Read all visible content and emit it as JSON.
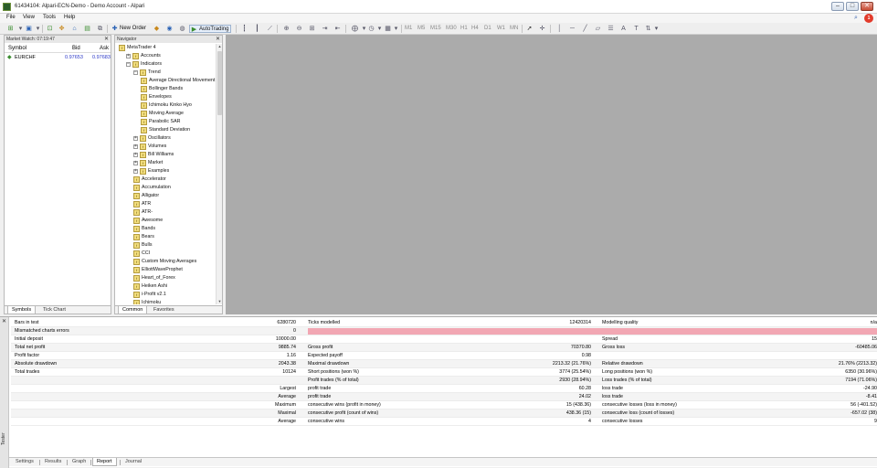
{
  "window": {
    "title": "61434104: Alpari-ECN-Demo - Demo Account - Alpari",
    "min": "–",
    "max": "□",
    "close": "✕"
  },
  "menu": [
    "File",
    "View",
    "Tools",
    "Help"
  ],
  "toolbar": {
    "new_order": "New Order",
    "auto_trading": "AutoTrading",
    "periods": [
      "M1",
      "M5",
      "M15",
      "M30",
      "H1",
      "H4",
      "D1",
      "W1",
      "MN"
    ]
  },
  "market_watch": {
    "title": "Market Watch: 07:19:47",
    "close": "✕",
    "headers": {
      "symbol": "Symbol",
      "bid": "Bid",
      "ask": "Ask"
    },
    "rows": [
      {
        "symbol": "EURCHF",
        "bid": "0.97653",
        "ask": "0.97683"
      }
    ],
    "tabs": [
      "Symbols",
      "Tick Chart"
    ]
  },
  "navigator": {
    "title": "Navigator",
    "close": "✕",
    "tree": [
      {
        "label": "MetaTrader 4",
        "level": 0,
        "exp": ""
      },
      {
        "label": "Accounts",
        "level": 1,
        "exp": "+"
      },
      {
        "label": "Indicators",
        "level": 1,
        "exp": "−"
      },
      {
        "label": "Trend",
        "level": 2,
        "exp": "−"
      },
      {
        "label": "Average Directional Movement Index",
        "level": 3,
        "exp": ""
      },
      {
        "label": "Bollinger Bands",
        "level": 3,
        "exp": ""
      },
      {
        "label": "Envelopes",
        "level": 3,
        "exp": ""
      },
      {
        "label": "Ichimoku Kinko Hyo",
        "level": 3,
        "exp": ""
      },
      {
        "label": "Moving Average",
        "level": 3,
        "exp": ""
      },
      {
        "label": "Parabolic SAR",
        "level": 3,
        "exp": ""
      },
      {
        "label": "Standard Deviation",
        "level": 3,
        "exp": ""
      },
      {
        "label": "Oscillators",
        "level": 2,
        "exp": "+"
      },
      {
        "label": "Volumes",
        "level": 2,
        "exp": "+"
      },
      {
        "label": "Bill Williams",
        "level": 2,
        "exp": "+"
      },
      {
        "label": "Market",
        "level": 2,
        "exp": "+"
      },
      {
        "label": "Examples",
        "level": 2,
        "exp": "+"
      },
      {
        "label": "Accelerator",
        "level": 2,
        "exp": ""
      },
      {
        "label": "Accumulation",
        "level": 2,
        "exp": ""
      },
      {
        "label": "Alligator",
        "level": 2,
        "exp": ""
      },
      {
        "label": "ATR",
        "level": 2,
        "exp": ""
      },
      {
        "label": "ATR-",
        "level": 2,
        "exp": ""
      },
      {
        "label": "Awesome",
        "level": 2,
        "exp": ""
      },
      {
        "label": "Bands",
        "level": 2,
        "exp": ""
      },
      {
        "label": "Bears",
        "level": 2,
        "exp": ""
      },
      {
        "label": "Bulls",
        "level": 2,
        "exp": ""
      },
      {
        "label": "CCI",
        "level": 2,
        "exp": ""
      },
      {
        "label": "Custom Moving Averages",
        "level": 2,
        "exp": ""
      },
      {
        "label": "ElliottWaveProphet",
        "level": 2,
        "exp": ""
      },
      {
        "label": "Heart_of_Forex",
        "level": 2,
        "exp": ""
      },
      {
        "label": "Heiken Ashi",
        "level": 2,
        "exp": ""
      },
      {
        "label": "i-Profit v2.1",
        "level": 2,
        "exp": ""
      },
      {
        "label": "Ichimoku",
        "level": 2,
        "exp": ""
      }
    ],
    "tabs": [
      "Common",
      "Favorites"
    ]
  },
  "report": {
    "rows": [
      [
        "Bars in test",
        "6280720",
        "Ticks modelled",
        "12420314",
        "Modelling quality",
        "n/a"
      ],
      [
        "Mismatched charts errors",
        "0",
        "",
        "",
        "",
        ""
      ],
      [
        "Initial deposit",
        "10000.00",
        "",
        "",
        "Spread",
        "15"
      ],
      [
        "Total net profit",
        "9885.74",
        "Gross profit",
        "70370.80",
        "Gross loss",
        "-60485.06"
      ],
      [
        "Profit factor",
        "1.16",
        "Expected payoff",
        "0.98",
        "",
        ""
      ],
      [
        "Absolute drawdown",
        "2043.38",
        "Maximal drawdown",
        "2213.32 (21.76%)",
        "Relative drawdown",
        "21.76% (2213.32)"
      ],
      [
        "Total trades",
        "10124",
        "Short positions (won %)",
        "3774 (25.54%)",
        "Long positions (won %)",
        "6350 (30.96%)"
      ],
      [
        "",
        "",
        "Profit trades (% of total)",
        "2930 (28.94%)",
        "Loss trades (% of total)",
        "7194 (71.06%)"
      ],
      [
        "",
        "Largest",
        "profit trade",
        "60.28",
        "loss trade",
        "-24.90"
      ],
      [
        "",
        "Average",
        "profit trade",
        "24.02",
        "loss trade",
        "-8.41"
      ],
      [
        "",
        "Maximum",
        "consecutive wins (profit in money)",
        "15 (438.36)",
        "consecutive losses (loss in money)",
        "56 (-401.52)"
      ],
      [
        "",
        "Maximal",
        "consecutive profit (count of wins)",
        "438.36 (15)",
        "consecutive loss (count of losses)",
        "-657.02 (38)"
      ],
      [
        "",
        "Average",
        "consecutive wins",
        "4",
        "consecutive losses",
        "9"
      ]
    ],
    "tabs": [
      "Settings",
      "Results",
      "Graph",
      "Report",
      "Journal"
    ],
    "active_tab": "Report",
    "side_label": "Tester",
    "close": "✕"
  },
  "colors": {
    "quality_bar": "#f2a7b3",
    "chart_bg": "#ababab",
    "value_blue": "#2a37c7"
  }
}
